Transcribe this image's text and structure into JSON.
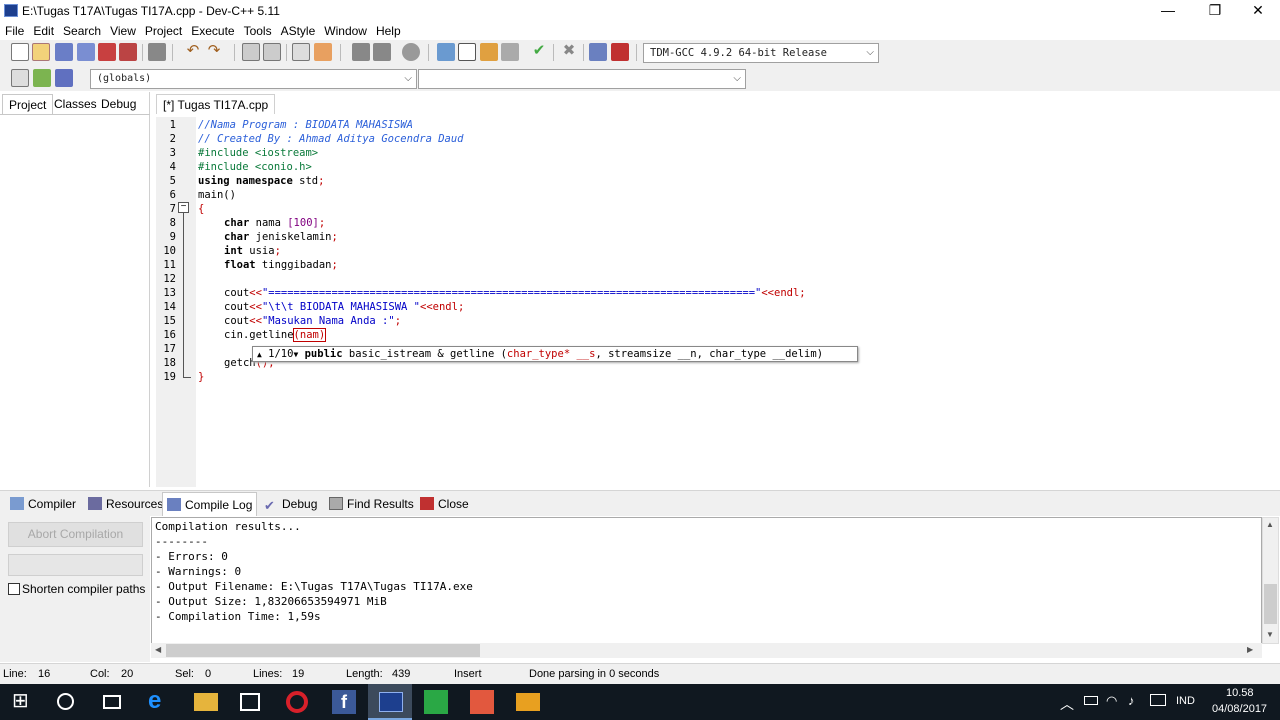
{
  "window": {
    "title": "E:\\Tugas T17A\\Tugas TI17A.cpp - Dev-C++ 5.11",
    "minimize_glyph": "—",
    "restore_glyph": "❐",
    "close_glyph": "✕"
  },
  "menu": [
    "File",
    "Edit",
    "Search",
    "View",
    "Project",
    "Execute",
    "Tools",
    "AStyle",
    "Window",
    "Help"
  ],
  "toolbar": {
    "compiler_select": "TDM-GCC 4.9.2 64-bit Release",
    "scope_select": "(globals)",
    "member_select": ""
  },
  "left_tabs": [
    "Project",
    "Classes",
    "Debug"
  ],
  "editor": {
    "tab_label": "[*] Tugas TI17A.cpp",
    "line_numbers": [
      "1",
      "2",
      "3",
      "4",
      "5",
      "6",
      "7",
      "8",
      "9",
      "10",
      "11",
      "12",
      "13",
      "14",
      "15",
      "16",
      "17",
      "18",
      "19"
    ],
    "fold_glyph": "−",
    "code": {
      "l1": "//Nama Program : BIODATA MAHASISWA",
      "l2": "// Created By : Ahmad Aditya Gocendra Daud",
      "l3": "#include <iostream>",
      "l4": "#include <conio.h>",
      "l5_kw": "using namespace",
      "l5_rest": " std",
      "l6": "main()",
      "l7": "{",
      "l8_kw": "char",
      "l8_rest": " nama ",
      "l8_num": "[100]",
      "l9_kw": "char",
      "l9_rest": " jeniskelamin",
      "l10_kw": "int",
      "l10_rest": " usia",
      "l11_kw": "float",
      "l11_rest": " tinggibadan",
      "l13_a": "cout",
      "l13_op": "<<",
      "l13_str": "\"=============================================================================\"",
      "l13_end": "<<endl",
      "l14_a": "cout",
      "l14_str": "\"\\t\\t BIODATA MAHASISWA \"",
      "l14_end": "<<endl",
      "l15_a": "cout",
      "l15_str": "\"Masukan Nama Anda :\"",
      "l16_a": "cin.getline",
      "l16_b": "(nam)",
      "l18_a": "getch",
      "l18_b": "()",
      "l19": "}",
      "semicolon": ";"
    },
    "hint": {
      "counter": "1/10",
      "up_glyph": "▲",
      "down_glyph": "▼",
      "kw": "public",
      "sig1": " basic_istream & getline (",
      "param1": "char_type* __s",
      "sig2": ", streamsize __n, char_type __delim)"
    }
  },
  "bottom_tabs": [
    "Compiler",
    "Resources",
    "Compile Log",
    "Debug",
    "Find Results",
    "Close"
  ],
  "bottom_panel": {
    "abort_label": "Abort Compilation",
    "shorten_label": "Shorten compiler paths",
    "log_lines": [
      "Compilation results...",
      "--------",
      "- Errors: 0",
      "- Warnings: 0",
      "- Output Filename: E:\\Tugas T17A\\Tugas TI17A.exe",
      "- Output Size: 1,83206653594971 MiB",
      "- Compilation Time: 1,59s"
    ],
    "scroll_up": "▲",
    "scroll_down": "▼",
    "scroll_left": "◀",
    "scroll_right": "▶"
  },
  "status": {
    "line_label": "Line:",
    "line_value": "16",
    "col_label": "Col:",
    "col_value": "20",
    "sel_label": "Sel:",
    "sel_value": "0",
    "lines_label": "Lines:",
    "lines_value": "19",
    "length_label": "Length:",
    "length_value": "439",
    "mode": "Insert",
    "message": "Done parsing in 0 seconds"
  },
  "taskbar": {
    "language": "IND",
    "time": "10.58",
    "date": "04/08/2017",
    "tray_chevron": "︿"
  },
  "colors": {
    "current_line": "#cef7f7",
    "comment": "#2b5fd9",
    "string": "#0000c8",
    "operator": "#c00000",
    "taskbar": "#101820"
  }
}
